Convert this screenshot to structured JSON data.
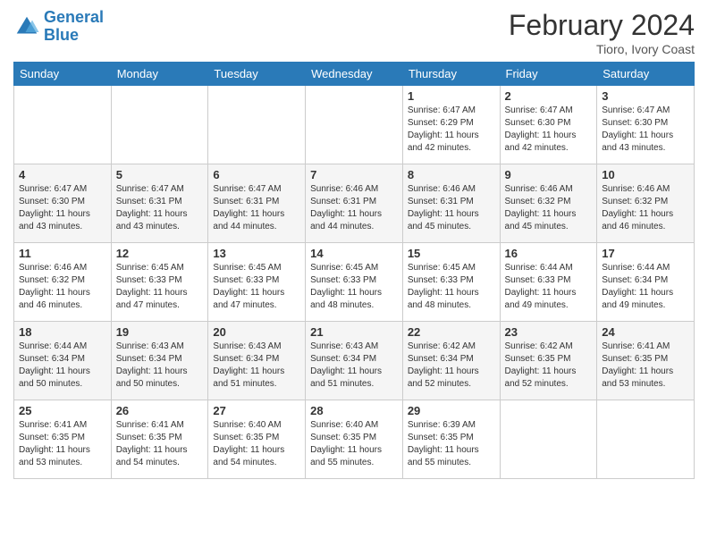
{
  "header": {
    "logo_line1": "General",
    "logo_line2": "Blue",
    "month_title": "February 2024",
    "location": "Tioro, Ivory Coast"
  },
  "days_of_week": [
    "Sunday",
    "Monday",
    "Tuesday",
    "Wednesday",
    "Thursday",
    "Friday",
    "Saturday"
  ],
  "weeks": [
    [
      {
        "day": "",
        "info": ""
      },
      {
        "day": "",
        "info": ""
      },
      {
        "day": "",
        "info": ""
      },
      {
        "day": "",
        "info": ""
      },
      {
        "day": "1",
        "info": "Sunrise: 6:47 AM\nSunset: 6:29 PM\nDaylight: 11 hours and 42 minutes."
      },
      {
        "day": "2",
        "info": "Sunrise: 6:47 AM\nSunset: 6:30 PM\nDaylight: 11 hours and 42 minutes."
      },
      {
        "day": "3",
        "info": "Sunrise: 6:47 AM\nSunset: 6:30 PM\nDaylight: 11 hours and 43 minutes."
      }
    ],
    [
      {
        "day": "4",
        "info": "Sunrise: 6:47 AM\nSunset: 6:30 PM\nDaylight: 11 hours and 43 minutes."
      },
      {
        "day": "5",
        "info": "Sunrise: 6:47 AM\nSunset: 6:31 PM\nDaylight: 11 hours and 43 minutes."
      },
      {
        "day": "6",
        "info": "Sunrise: 6:47 AM\nSunset: 6:31 PM\nDaylight: 11 hours and 44 minutes."
      },
      {
        "day": "7",
        "info": "Sunrise: 6:46 AM\nSunset: 6:31 PM\nDaylight: 11 hours and 44 minutes."
      },
      {
        "day": "8",
        "info": "Sunrise: 6:46 AM\nSunset: 6:31 PM\nDaylight: 11 hours and 45 minutes."
      },
      {
        "day": "9",
        "info": "Sunrise: 6:46 AM\nSunset: 6:32 PM\nDaylight: 11 hours and 45 minutes."
      },
      {
        "day": "10",
        "info": "Sunrise: 6:46 AM\nSunset: 6:32 PM\nDaylight: 11 hours and 46 minutes."
      }
    ],
    [
      {
        "day": "11",
        "info": "Sunrise: 6:46 AM\nSunset: 6:32 PM\nDaylight: 11 hours and 46 minutes."
      },
      {
        "day": "12",
        "info": "Sunrise: 6:45 AM\nSunset: 6:33 PM\nDaylight: 11 hours and 47 minutes."
      },
      {
        "day": "13",
        "info": "Sunrise: 6:45 AM\nSunset: 6:33 PM\nDaylight: 11 hours and 47 minutes."
      },
      {
        "day": "14",
        "info": "Sunrise: 6:45 AM\nSunset: 6:33 PM\nDaylight: 11 hours and 48 minutes."
      },
      {
        "day": "15",
        "info": "Sunrise: 6:45 AM\nSunset: 6:33 PM\nDaylight: 11 hours and 48 minutes."
      },
      {
        "day": "16",
        "info": "Sunrise: 6:44 AM\nSunset: 6:33 PM\nDaylight: 11 hours and 49 minutes."
      },
      {
        "day": "17",
        "info": "Sunrise: 6:44 AM\nSunset: 6:34 PM\nDaylight: 11 hours and 49 minutes."
      }
    ],
    [
      {
        "day": "18",
        "info": "Sunrise: 6:44 AM\nSunset: 6:34 PM\nDaylight: 11 hours and 50 minutes."
      },
      {
        "day": "19",
        "info": "Sunrise: 6:43 AM\nSunset: 6:34 PM\nDaylight: 11 hours and 50 minutes."
      },
      {
        "day": "20",
        "info": "Sunrise: 6:43 AM\nSunset: 6:34 PM\nDaylight: 11 hours and 51 minutes."
      },
      {
        "day": "21",
        "info": "Sunrise: 6:43 AM\nSunset: 6:34 PM\nDaylight: 11 hours and 51 minutes."
      },
      {
        "day": "22",
        "info": "Sunrise: 6:42 AM\nSunset: 6:34 PM\nDaylight: 11 hours and 52 minutes."
      },
      {
        "day": "23",
        "info": "Sunrise: 6:42 AM\nSunset: 6:35 PM\nDaylight: 11 hours and 52 minutes."
      },
      {
        "day": "24",
        "info": "Sunrise: 6:41 AM\nSunset: 6:35 PM\nDaylight: 11 hours and 53 minutes."
      }
    ],
    [
      {
        "day": "25",
        "info": "Sunrise: 6:41 AM\nSunset: 6:35 PM\nDaylight: 11 hours and 53 minutes."
      },
      {
        "day": "26",
        "info": "Sunrise: 6:41 AM\nSunset: 6:35 PM\nDaylight: 11 hours and 54 minutes."
      },
      {
        "day": "27",
        "info": "Sunrise: 6:40 AM\nSunset: 6:35 PM\nDaylight: 11 hours and 54 minutes."
      },
      {
        "day": "28",
        "info": "Sunrise: 6:40 AM\nSunset: 6:35 PM\nDaylight: 11 hours and 55 minutes."
      },
      {
        "day": "29",
        "info": "Sunrise: 6:39 AM\nSunset: 6:35 PM\nDaylight: 11 hours and 55 minutes."
      },
      {
        "day": "",
        "info": ""
      },
      {
        "day": "",
        "info": ""
      }
    ]
  ]
}
